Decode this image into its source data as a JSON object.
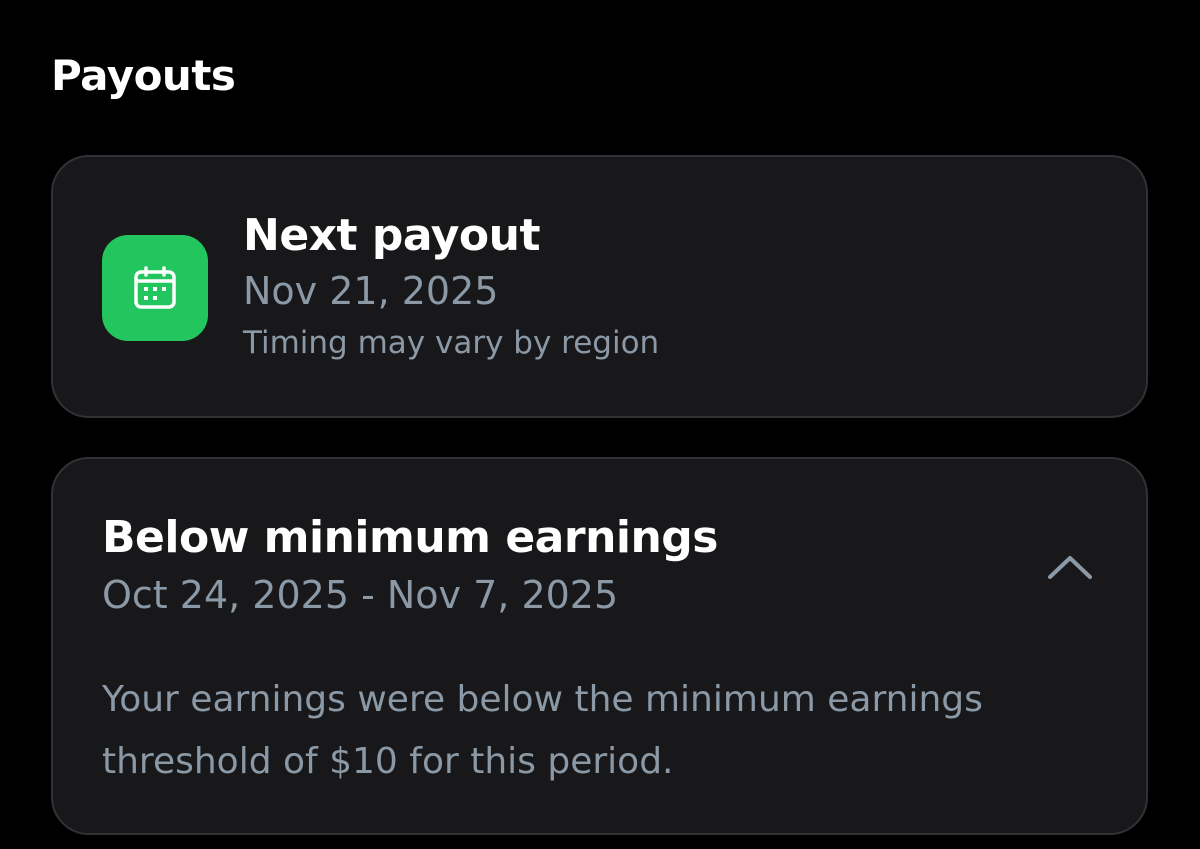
{
  "header": {
    "title": "Payouts"
  },
  "next_payout": {
    "icon": "calendar-icon",
    "title": "Next payout",
    "date": "Nov 21, 2025",
    "note": "Timing may vary by region",
    "icon_color": "#22c55e"
  },
  "earnings": {
    "title": "Below minimum earnings",
    "period": "Oct 24, 2025 - Nov 7, 2025",
    "description": "Your earnings were below the minimum earnings threshold of $10 for this period.",
    "toggle_icon": "chevron-up-icon",
    "expanded": true
  },
  "colors": {
    "background": "#000000",
    "card": "#18181b",
    "card_border": "#2f3336",
    "primary_text": "#ffffff",
    "secondary_text": "#8b98a5",
    "accent": "#22c55e"
  }
}
